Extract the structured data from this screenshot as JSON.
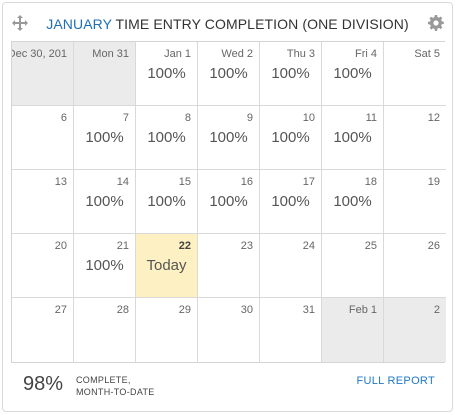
{
  "header": {
    "title_month": "JANUARY",
    "title_rest": " TIME ENTRY COMPLETION (ONE DIVISION)",
    "move_icon": "move-arrows-icon",
    "settings_icon": "gear-icon"
  },
  "calendar": {
    "weeks": [
      [
        {
          "day": "Dec 30, 201",
          "value": "",
          "state": "outside"
        },
        {
          "day": "Mon 31",
          "value": "",
          "state": "outside"
        },
        {
          "day": "Jan 1",
          "value": "100%",
          "state": "normal"
        },
        {
          "day": "Wed 2",
          "value": "100%",
          "state": "normal"
        },
        {
          "day": "Thu 3",
          "value": "100%",
          "state": "normal"
        },
        {
          "day": "Fri 4",
          "value": "100%",
          "state": "normal"
        },
        {
          "day": "Sat 5",
          "value": "",
          "state": "normal"
        }
      ],
      [
        {
          "day": "6",
          "value": "",
          "state": "normal"
        },
        {
          "day": "7",
          "value": "100%",
          "state": "normal"
        },
        {
          "day": "8",
          "value": "100%",
          "state": "normal"
        },
        {
          "day": "9",
          "value": "100%",
          "state": "normal"
        },
        {
          "day": "10",
          "value": "100%",
          "state": "normal"
        },
        {
          "day": "11",
          "value": "100%",
          "state": "normal"
        },
        {
          "day": "12",
          "value": "",
          "state": "normal"
        }
      ],
      [
        {
          "day": "13",
          "value": "",
          "state": "normal"
        },
        {
          "day": "14",
          "value": "100%",
          "state": "normal"
        },
        {
          "day": "15",
          "value": "100%",
          "state": "normal"
        },
        {
          "day": "16",
          "value": "100%",
          "state": "normal"
        },
        {
          "day": "17",
          "value": "100%",
          "state": "normal"
        },
        {
          "day": "18",
          "value": "100%",
          "state": "normal"
        },
        {
          "day": "19",
          "value": "",
          "state": "normal"
        }
      ],
      [
        {
          "day": "20",
          "value": "",
          "state": "normal"
        },
        {
          "day": "21",
          "value": "100%",
          "state": "normal"
        },
        {
          "day": "22",
          "value": "Today",
          "state": "today"
        },
        {
          "day": "23",
          "value": "",
          "state": "normal"
        },
        {
          "day": "24",
          "value": "",
          "state": "normal"
        },
        {
          "day": "25",
          "value": "",
          "state": "normal"
        },
        {
          "day": "26",
          "value": "",
          "state": "normal"
        }
      ],
      [
        {
          "day": "27",
          "value": "",
          "state": "normal"
        },
        {
          "day": "28",
          "value": "",
          "state": "normal"
        },
        {
          "day": "29",
          "value": "",
          "state": "normal"
        },
        {
          "day": "30",
          "value": "",
          "state": "normal"
        },
        {
          "day": "31",
          "value": "",
          "state": "normal"
        },
        {
          "day": "Feb 1",
          "value": "",
          "state": "outside"
        },
        {
          "day": "2",
          "value": "",
          "state": "outside"
        }
      ]
    ]
  },
  "footer": {
    "percent": "98%",
    "label_line1": "COMPLETE,",
    "label_line2": "MONTH-TO-DATE",
    "link": "FULL REPORT"
  },
  "colors": {
    "accent": "#1f6fb8",
    "today_bg": "#fdf0c2",
    "outside_bg": "#ebebeb"
  }
}
